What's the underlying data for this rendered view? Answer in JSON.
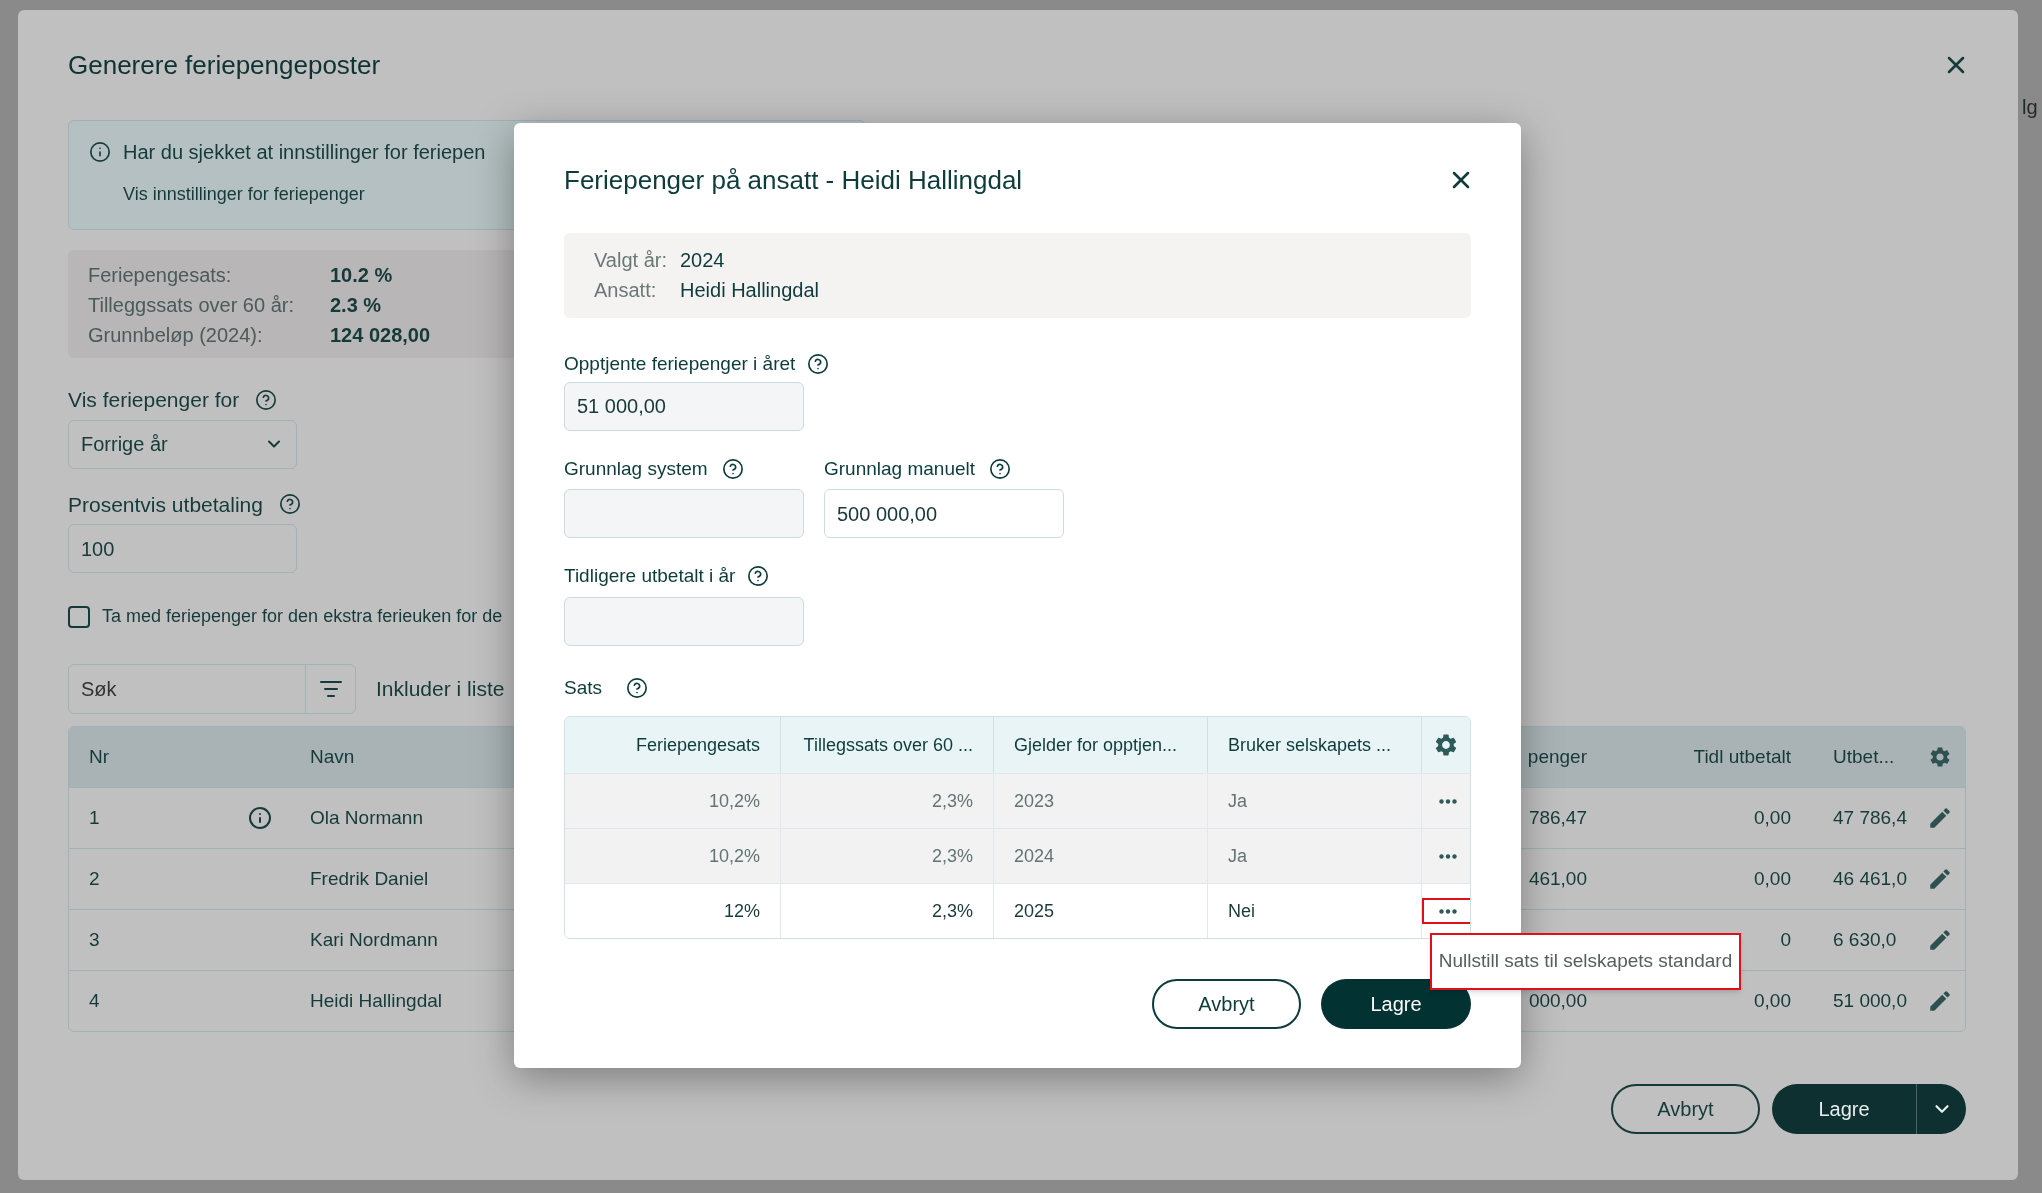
{
  "page": {
    "edge_text": "lg"
  },
  "dialog": {
    "title": "Generere feriepengeposter",
    "info": {
      "text": "Har du sjekket at innstillinger for feriepen",
      "link": "Vis innstillinger for feriepenger"
    },
    "stats": [
      {
        "label": "Feriepengesats:",
        "value": "10.2 %"
      },
      {
        "label": "Tilleggssats over 60 år:",
        "value": "2.3 %"
      },
      {
        "label": "Grunnbeløp (2024):",
        "value": "124 028,00"
      }
    ],
    "view_for": {
      "label": "Vis feriepenger for",
      "value": "Forrige år"
    },
    "percent": {
      "label": "Prosentvis utbetaling",
      "value": "100"
    },
    "extra_week": {
      "label": "Ta med feriepenger for den ekstra ferieuken for de",
      "checked": false
    },
    "search": {
      "placeholder": "Søk"
    },
    "include_label": "Inkluder i liste",
    "table": {
      "columns": [
        "Nr",
        "Navn",
        "penger",
        "Tidl utbetalt",
        "Utbet..."
      ],
      "rows": [
        {
          "nr": "1",
          "has_info": true,
          "name": "Ola Normann",
          "penger": "786,47",
          "tidl": "0,00",
          "utbet": "47 786,4"
        },
        {
          "nr": "2",
          "has_info": false,
          "name": "Fredrik Daniel",
          "penger": "461,00",
          "tidl": "0,00",
          "utbet": "46 461,0"
        },
        {
          "nr": "3",
          "has_info": false,
          "name": "Kari Nordmann",
          "tidl": "0",
          "utbet": "6 630,0"
        },
        {
          "nr": "4",
          "has_info": false,
          "name": "Heidi Hallingdal",
          "penger": "000,00",
          "tidl": "0,00",
          "utbet": "51 000,0"
        }
      ]
    },
    "buttons": {
      "cancel": "Avbryt",
      "save": "Lagre"
    }
  },
  "modal": {
    "title": "Feriepenger på ansatt - Heidi Hallingdal",
    "summary": [
      {
        "label": "Valgt år:",
        "value": "2024"
      },
      {
        "label": "Ansatt:",
        "value": "Heidi Hallingdal"
      }
    ],
    "earned": {
      "label": "Opptjente feriepenger i året",
      "value": "51 000,00",
      "disabled": true
    },
    "base_system": {
      "label": "Grunnlag system",
      "disabled": true
    },
    "base_manual": {
      "label": "Grunnlag manuelt",
      "value": "500 000,00",
      "disabled": false
    },
    "paid_earlier": {
      "label": "Tidligere utbetalt i år",
      "disabled": true
    },
    "rates_label": "Sats",
    "rates": {
      "columns": [
        "Feriepengesats",
        "Tillegssats over 60 ...",
        "Gjelder for opptjen...",
        "Bruker selskapets ..."
      ],
      "rows": [
        {
          "sats": "10,2%",
          "tillegg": "2,3%",
          "gjelder": "2023",
          "bruker": "Ja",
          "disabled": true,
          "menu_highlighted": false
        },
        {
          "sats": "10,2%",
          "tillegg": "2,3%",
          "gjelder": "2024",
          "bruker": "Ja",
          "disabled": true,
          "menu_highlighted": false
        },
        {
          "sats": "12%",
          "tillegg": "2,3%",
          "gjelder": "2025",
          "bruker": "Nei",
          "disabled": false,
          "menu_highlighted": true
        }
      ]
    },
    "tooltip": {
      "text": "Nullstill sats til selskapets standard",
      "highlighted": true
    },
    "buttons": {
      "cancel": "Avbryt",
      "save": "Lagre"
    }
  }
}
